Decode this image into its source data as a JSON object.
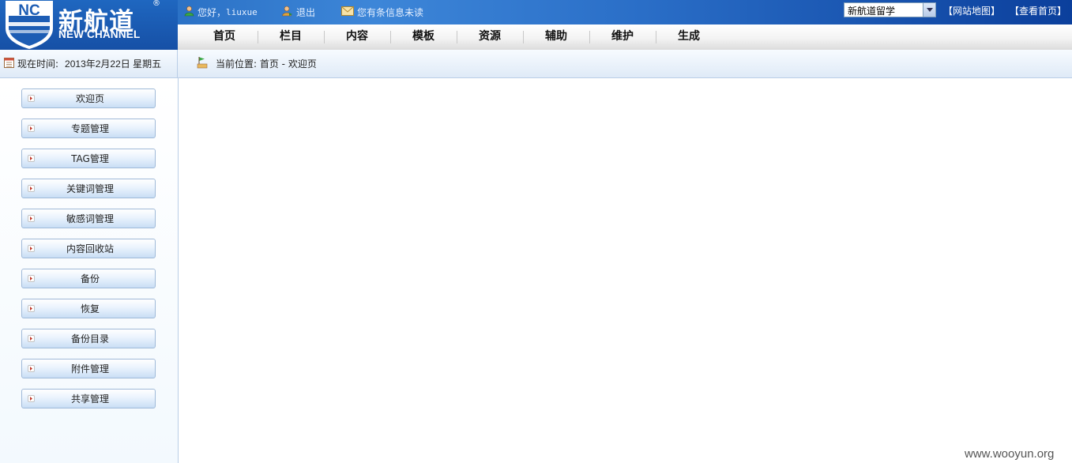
{
  "logo": {
    "mark": "NC",
    "cn": "新航道",
    "en": "NEW CHANNEL",
    "reg": "®"
  },
  "topbar": {
    "greeting": "您好，",
    "username": "liuxue",
    "logout": "退出",
    "message": "您有条信息未读",
    "site_select": "新航道留学",
    "sitemap_link": "【网站地图】",
    "view_home_link": "【查看首页】"
  },
  "nav": {
    "items": [
      {
        "label": "首页"
      },
      {
        "label": "栏目"
      },
      {
        "label": "内容"
      },
      {
        "label": "模板"
      },
      {
        "label": "资源"
      },
      {
        "label": "辅助"
      },
      {
        "label": "维护"
      },
      {
        "label": "生成"
      }
    ]
  },
  "infobar": {
    "time_label": "现在时间:",
    "time_value": "2013年2月22日 星期五",
    "location_label": "当前位置: 首页 - 欢迎页"
  },
  "sidebar": {
    "items": [
      {
        "label": "欢迎页"
      },
      {
        "label": "专题管理"
      },
      {
        "label": "TAG管理"
      },
      {
        "label": "关键词管理"
      },
      {
        "label": "敏感词管理"
      },
      {
        "label": "内容回收站"
      },
      {
        "label": "备份"
      },
      {
        "label": "恢复"
      },
      {
        "label": "备份目录"
      },
      {
        "label": "附件管理"
      },
      {
        "label": "共享管理"
      }
    ]
  },
  "watermark": "www.wooyun.org",
  "colors": {
    "header_blue": "#1b5fb5",
    "sidebar_border": "#9fb9d8",
    "bullet_red": "#c0392b"
  }
}
